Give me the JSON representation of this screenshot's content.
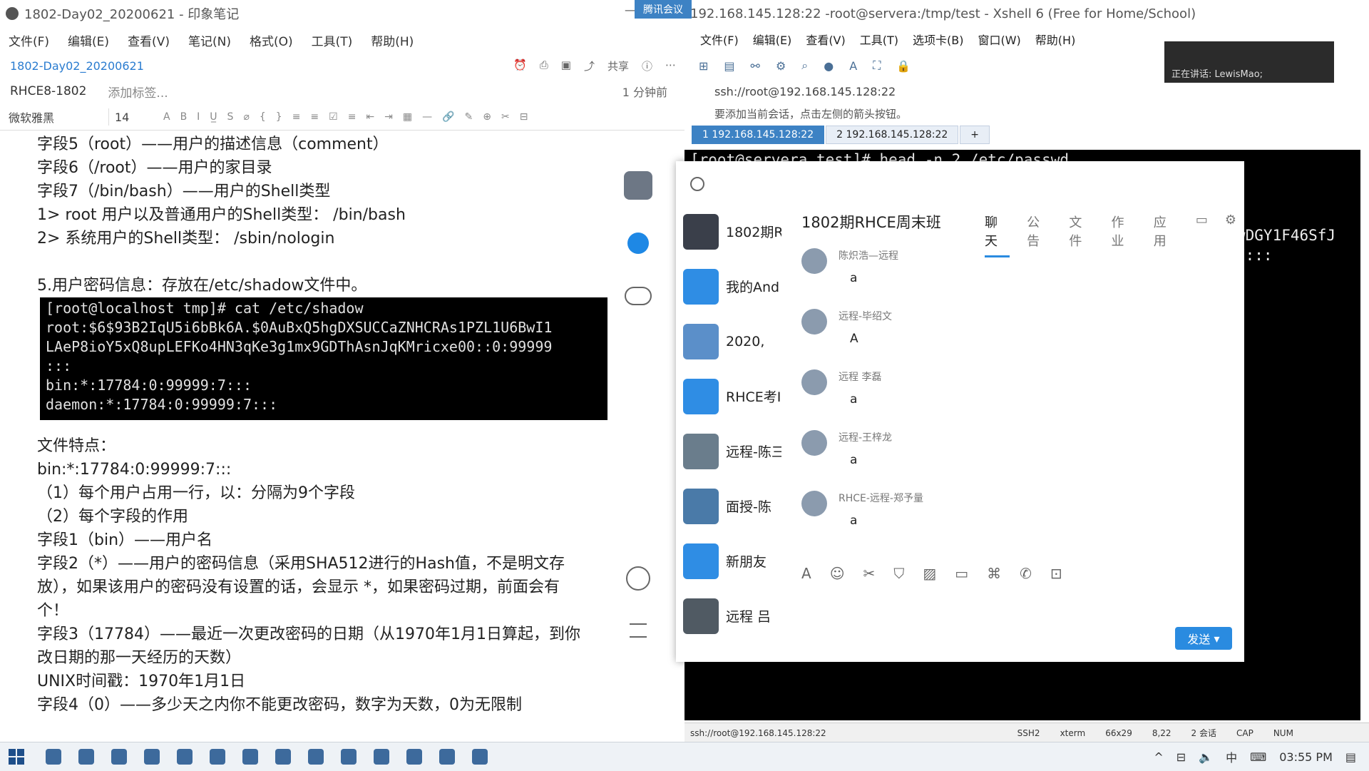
{
  "evernote": {
    "title": "1802-Day02_20200621 - 印象笔记",
    "menu": [
      "文件(F)",
      "编辑(E)",
      "查看(V)",
      "笔记(N)",
      "格式(O)",
      "工具(T)",
      "帮助(H)"
    ],
    "note_name": "1802-Day02_20200621",
    "share_label": "共享",
    "notebook": "RHCE8-1802",
    "add_tag": "添加标签...",
    "edited": "1 分钟前",
    "font": "微软雅黑",
    "font_size": "14",
    "lines_top": [
      "字段5（root）——用户的描述信息（comment）",
      "字段6（/root）——用户的家目录",
      "字段7（/bin/bash）——用户的Shell类型",
      "1> root 用户以及普通用户的Shell类型：  /bin/bash",
      "2> 系统用户的Shell类型：  /sbin/nologin",
      "",
      "5.用户密码信息：存放在/etc/shadow文件中。"
    ],
    "terminal_lines": [
      "[root@localhost tmp]# cat /etc/shadow",
      "root:$6$93B2IqU5i6bBk6A.$0AuBxQ5hgDXSUCCaZNHCRAs1PZL1U6BwI1",
      "LAeP8ioY5xQ8upLEFKo4HN3qKe3g1mx9GDThAsnJqKMricxe00::0:99999",
      ":::",
      "bin:*:17784:0:99999:7:::",
      "daemon:*:17784:0:99999:7:::"
    ],
    "lines_bottom": [
      "文件特点：",
      "bin:*:17784:0:99999:7:::",
      "（1）每个用户占用一行，以：分隔为9个字段",
      "（2）每个字段的作用",
      "字段1（bin）——用户名",
      "字段2（*）——用户的密码信息（采用SHA512进行的Hash值，不是明文存",
      "放），如果该用户的密码没有设置的话，会显示 *，如果密码过期，前面会有",
      "个！",
      "字段3（17784）——最近一次更改密码的日期（从1970年1月1日算起，到你",
      "改日期的那一天经历的天数）",
      "UNIX时间戳：1970年1月1日",
      "字段4（0）——多少天之内你不能更改密码，数字为天数，0为无限制"
    ]
  },
  "xshell": {
    "title": "root@servera:/tmp/test - Xshell 6 (Free for Home/School)",
    "badge": "腾讯会议",
    "title_prefix": "192.168.145.128:22 - ",
    "menu": [
      "文件(F)",
      "编辑(E)",
      "查看(V)",
      "工具(T)",
      "选项卡(B)",
      "窗口(W)",
      "帮助(H)"
    ],
    "address": "ssh://root@192.168.145.128:22",
    "hint": "要添加当前会话，点击左侧的箭头按钮。",
    "tabs": [
      "1 192.168.145.128:22",
      "2 192.168.145.128:22"
    ],
    "terminal_lines": [
      "[root@servera test]# head -n 2 /etc/passwd"
    ],
    "terminal_right": [
      "wDGY1F46SfJ",
      "7:::"
    ],
    "status": [
      "ssh://root@192.168.145.128:22",
      "SSH2",
      "xterm",
      "66x29",
      "8,22",
      "2 会话",
      "CAP",
      "NUM"
    ]
  },
  "meeting": {
    "speaking": "正在讲话: LewisMao;"
  },
  "qq": {
    "group_title": "1802期RHCE周末班",
    "tabs": [
      "聊天",
      "公告",
      "文件",
      "作业",
      "应用"
    ],
    "contacts": [
      {
        "name": "1802期R",
        "color": "#3a3f4a"
      },
      {
        "name": "我的And",
        "color": "#2f8de4"
      },
      {
        "name": "2020,",
        "color": "#5b8fc9"
      },
      {
        "name": "RHCE考I",
        "color": "#2f8de4"
      },
      {
        "name": "远程-陈三",
        "color": "#6a7d8c"
      },
      {
        "name": "面授-陈",
        "color": "#4a7aa8"
      },
      {
        "name": "新朋友",
        "color": "#2f8de4"
      },
      {
        "name": "远程 吕",
        "color": "#505a63"
      }
    ],
    "messages": [
      {
        "sender": "陈炽浩—远程",
        "text": "a"
      },
      {
        "sender": "远程-毕绍文",
        "text": "A"
      },
      {
        "sender": "远程 李磊",
        "text": "a"
      },
      {
        "sender": "远程-王梓龙",
        "text": "a"
      },
      {
        "sender": "RHCE-远程-郑予量",
        "text": "a"
      }
    ],
    "send_label": "发送"
  },
  "taskbar": {
    "ime": "中",
    "time": "03:55 PM"
  }
}
